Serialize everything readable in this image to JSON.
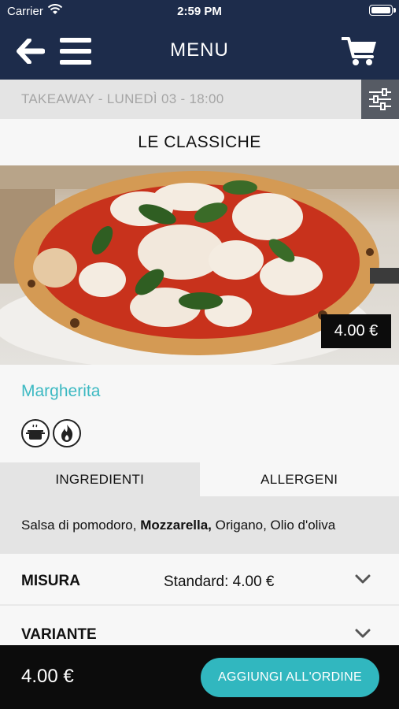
{
  "status_bar": {
    "carrier": "Carrier",
    "time": "2:59 PM"
  },
  "header": {
    "title": "MENU",
    "icons": [
      "back-arrow-icon",
      "hamburger-menu-icon",
      "cart-icon"
    ]
  },
  "takeaway": {
    "text": "TAKEAWAY - LUNEDÌ 03 - 18:00",
    "filter_icon": "sliders-icon"
  },
  "category": {
    "title": "LE CLASSICHE"
  },
  "product": {
    "price_badge": "4.00 €",
    "name": "Margherita",
    "tags": [
      "cooking-pot-icon",
      "flame-icon"
    ],
    "accent_color": "#3cb9c2"
  },
  "tabs": [
    {
      "label": "INGREDIENTI",
      "active": true
    },
    {
      "label": "ALLERGENI",
      "active": false
    }
  ],
  "ingredients": {
    "part1": "Salsa di pomodoro, ",
    "bold": "Mozzarella,",
    "part2": " Origano, Olio d'oliva"
  },
  "options": [
    {
      "label": "MISURA",
      "value": "Standard: 4.00 €"
    },
    {
      "label": "VARIANTE",
      "value": ""
    }
  ],
  "footer": {
    "total": "4.00 €",
    "add_button": "AGGIUNGI ALL'ORDINE",
    "button_color": "#31b7bf"
  }
}
